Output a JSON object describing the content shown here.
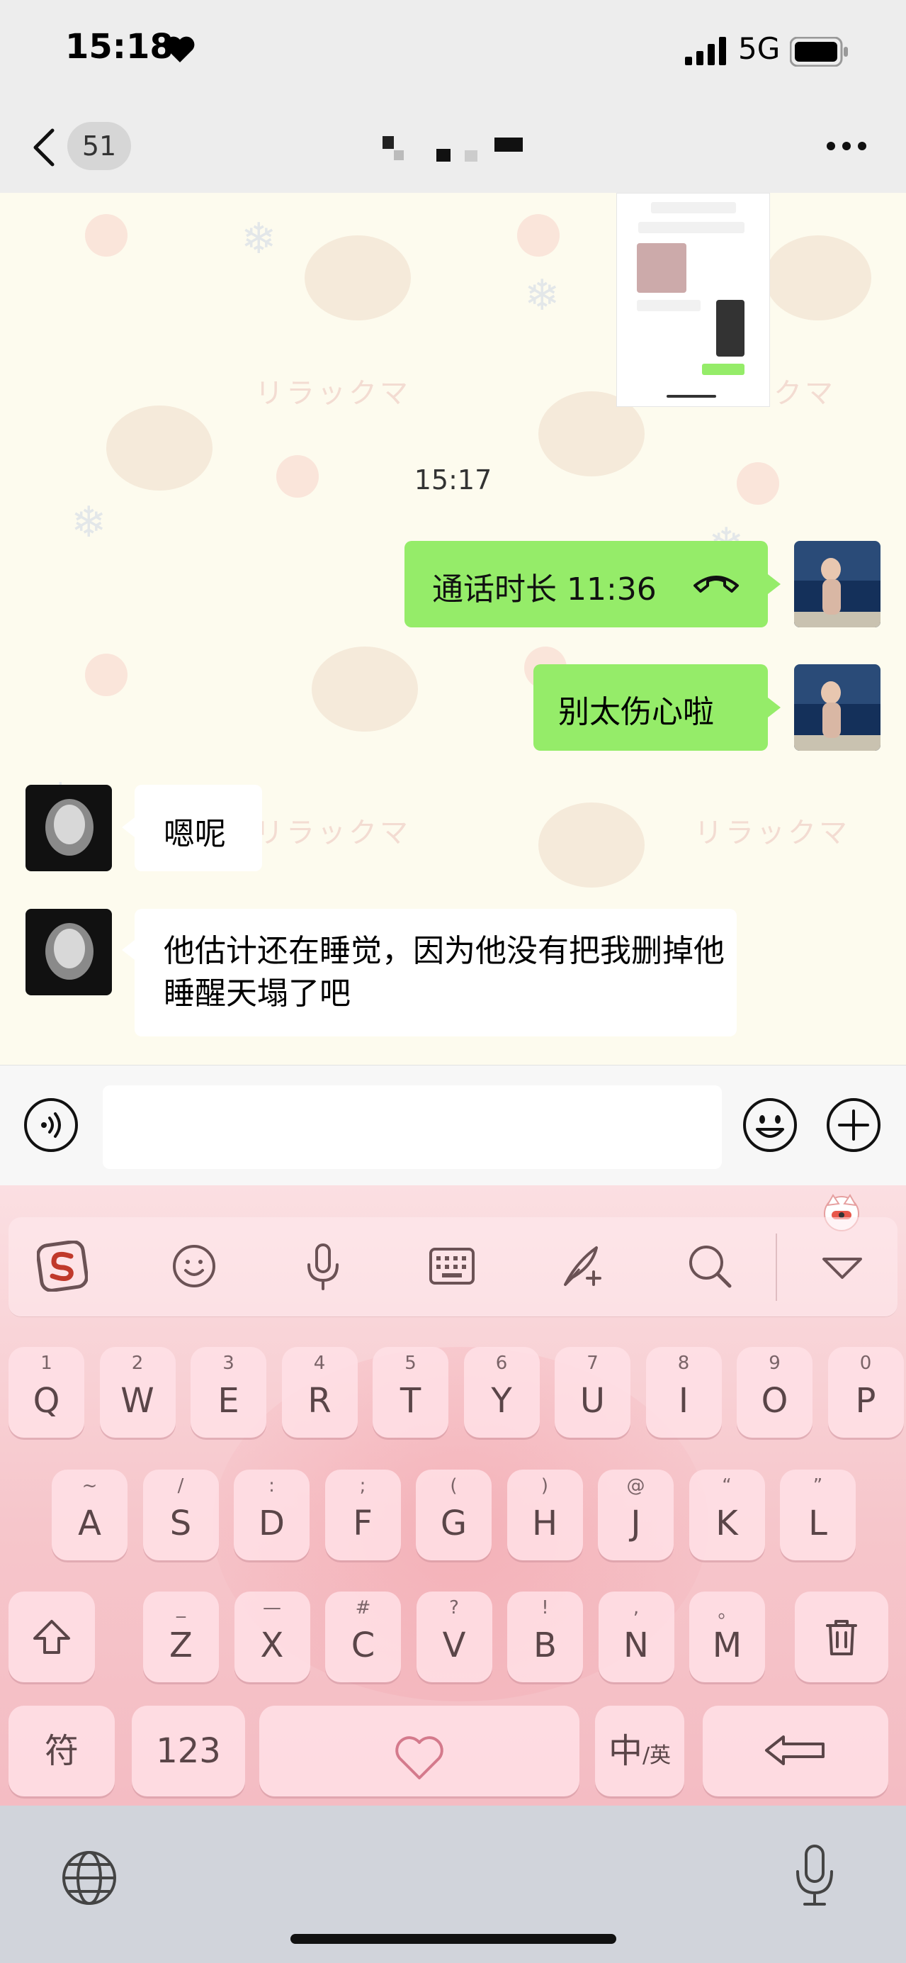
{
  "status_bar": {
    "time": "15:18",
    "network": "5G"
  },
  "nav": {
    "unread_count": "51"
  },
  "chat": {
    "timestamp": "15:17",
    "call": {
      "text": "通话时长 11:36"
    },
    "messages": [
      {
        "side": "out",
        "text": "别太伤心啦"
      },
      {
        "side": "in",
        "text": "嗯呢"
      },
      {
        "side": "in",
        "text": "他估计还在睡觉，因为他没有把我删掉他睡醒天塌了吧"
      }
    ],
    "watermark": "リラックマ"
  },
  "input": {
    "placeholder": ""
  },
  "keyboard": {
    "row1": [
      {
        "sub": "1",
        "key": "Q"
      },
      {
        "sub": "2",
        "key": "W"
      },
      {
        "sub": "3",
        "key": "E"
      },
      {
        "sub": "4",
        "key": "R"
      },
      {
        "sub": "5",
        "key": "T"
      },
      {
        "sub": "6",
        "key": "Y"
      },
      {
        "sub": "7",
        "key": "U"
      },
      {
        "sub": "8",
        "key": "I"
      },
      {
        "sub": "9",
        "key": "O"
      },
      {
        "sub": "0",
        "key": "P"
      }
    ],
    "row2": [
      {
        "sub": "~",
        "key": "A"
      },
      {
        "sub": "/",
        "key": "S"
      },
      {
        "sub": ":",
        "key": "D"
      },
      {
        "sub": ";",
        "key": "F"
      },
      {
        "sub": "(",
        "key": "G"
      },
      {
        "sub": ")",
        "key": "H"
      },
      {
        "sub": "@",
        "key": "J"
      },
      {
        "sub": "“",
        "key": "K"
      },
      {
        "sub": "”",
        "key": "L"
      }
    ],
    "row3": [
      {
        "sub": "_",
        "key": "Z"
      },
      {
        "sub": "—",
        "key": "X"
      },
      {
        "sub": "#",
        "key": "C"
      },
      {
        "sub": "?",
        "key": "V"
      },
      {
        "sub": "!",
        "key": "B"
      },
      {
        "sub": ",",
        "key": "N"
      },
      {
        "sub": "。",
        "key": "M"
      }
    ],
    "symbol_key": "符",
    "number_key": "123",
    "lang_key_main": "中",
    "lang_key_sub": "/英"
  },
  "colors": {
    "sent_bubble": "#95ec69",
    "received_bubble": "#ffffff",
    "nav_bg": "#ededed"
  }
}
